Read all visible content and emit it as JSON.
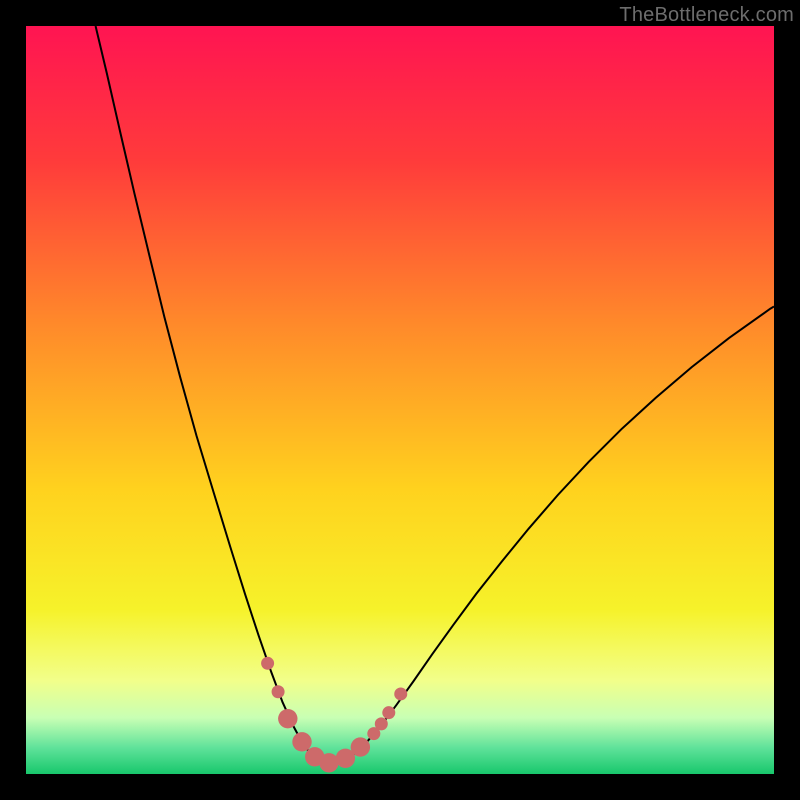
{
  "watermark": {
    "text": "TheBottleneck.com"
  },
  "chart_data": {
    "type": "line",
    "title": "",
    "xlabel": "",
    "ylabel": "",
    "xlim": [
      0,
      100
    ],
    "ylim": [
      0,
      100
    ],
    "grid": false,
    "gradient_stops": [
      {
        "offset": 0,
        "color": "#ff1452"
      },
      {
        "offset": 0.18,
        "color": "#ff3b3b"
      },
      {
        "offset": 0.4,
        "color": "#ff8a2a"
      },
      {
        "offset": 0.62,
        "color": "#ffd21e"
      },
      {
        "offset": 0.78,
        "color": "#f6f22a"
      },
      {
        "offset": 0.875,
        "color": "#f2ff8a"
      },
      {
        "offset": 0.925,
        "color": "#c8ffb4"
      },
      {
        "offset": 0.965,
        "color": "#5fe29a"
      },
      {
        "offset": 1.0,
        "color": "#18c76c"
      }
    ],
    "curve": {
      "points": [
        {
          "x": 9.3,
          "y": 100.0
        },
        {
          "x": 10.8,
          "y": 93.7
        },
        {
          "x": 12.6,
          "y": 85.8
        },
        {
          "x": 14.5,
          "y": 77.6
        },
        {
          "x": 16.5,
          "y": 69.3
        },
        {
          "x": 18.5,
          "y": 61.1
        },
        {
          "x": 20.6,
          "y": 53.1
        },
        {
          "x": 22.8,
          "y": 45.2
        },
        {
          "x": 25.1,
          "y": 37.6
        },
        {
          "x": 27.3,
          "y": 30.4
        },
        {
          "x": 29.3,
          "y": 24.0
        },
        {
          "x": 31.1,
          "y": 18.5
        },
        {
          "x": 32.8,
          "y": 13.6
        },
        {
          "x": 34.3,
          "y": 9.6
        },
        {
          "x": 35.8,
          "y": 6.3
        },
        {
          "x": 37.1,
          "y": 3.9
        },
        {
          "x": 38.4,
          "y": 2.3
        },
        {
          "x": 39.7,
          "y": 1.5
        },
        {
          "x": 41.1,
          "y": 1.4
        },
        {
          "x": 42.4,
          "y": 1.7
        },
        {
          "x": 43.9,
          "y": 2.7
        },
        {
          "x": 45.5,
          "y": 4.2
        },
        {
          "x": 47.4,
          "y": 6.4
        },
        {
          "x": 49.5,
          "y": 9.2
        },
        {
          "x": 51.8,
          "y": 12.4
        },
        {
          "x": 54.3,
          "y": 16.0
        },
        {
          "x": 57.1,
          "y": 19.9
        },
        {
          "x": 60.2,
          "y": 24.1
        },
        {
          "x": 63.6,
          "y": 28.4
        },
        {
          "x": 67.2,
          "y": 32.8
        },
        {
          "x": 71.1,
          "y": 37.3
        },
        {
          "x": 75.2,
          "y": 41.7
        },
        {
          "x": 79.6,
          "y": 46.1
        },
        {
          "x": 84.2,
          "y": 50.3
        },
        {
          "x": 89.0,
          "y": 54.4
        },
        {
          "x": 94.0,
          "y": 58.3
        },
        {
          "x": 99.5,
          "y": 62.2
        },
        {
          "x": 100.0,
          "y": 62.5
        }
      ]
    },
    "markers": [
      {
        "x": 32.3,
        "y": 14.8,
        "r": 6.5
      },
      {
        "x": 33.7,
        "y": 11.0,
        "r": 6.5
      },
      {
        "x": 35.0,
        "y": 7.4,
        "r": 9.7
      },
      {
        "x": 36.9,
        "y": 4.3,
        "r": 9.7
      },
      {
        "x": 38.6,
        "y": 2.3,
        "r": 9.7
      },
      {
        "x": 40.5,
        "y": 1.5,
        "r": 9.7
      },
      {
        "x": 42.7,
        "y": 2.1,
        "r": 9.7
      },
      {
        "x": 44.7,
        "y": 3.6,
        "r": 9.7
      },
      {
        "x": 46.5,
        "y": 5.4,
        "r": 6.5
      },
      {
        "x": 47.5,
        "y": 6.7,
        "r": 6.5
      },
      {
        "x": 48.5,
        "y": 8.2,
        "r": 6.5
      },
      {
        "x": 50.1,
        "y": 10.7,
        "r": 6.5
      }
    ],
    "marker_color": "#cd6a6a",
    "curve_color": "#000000"
  }
}
